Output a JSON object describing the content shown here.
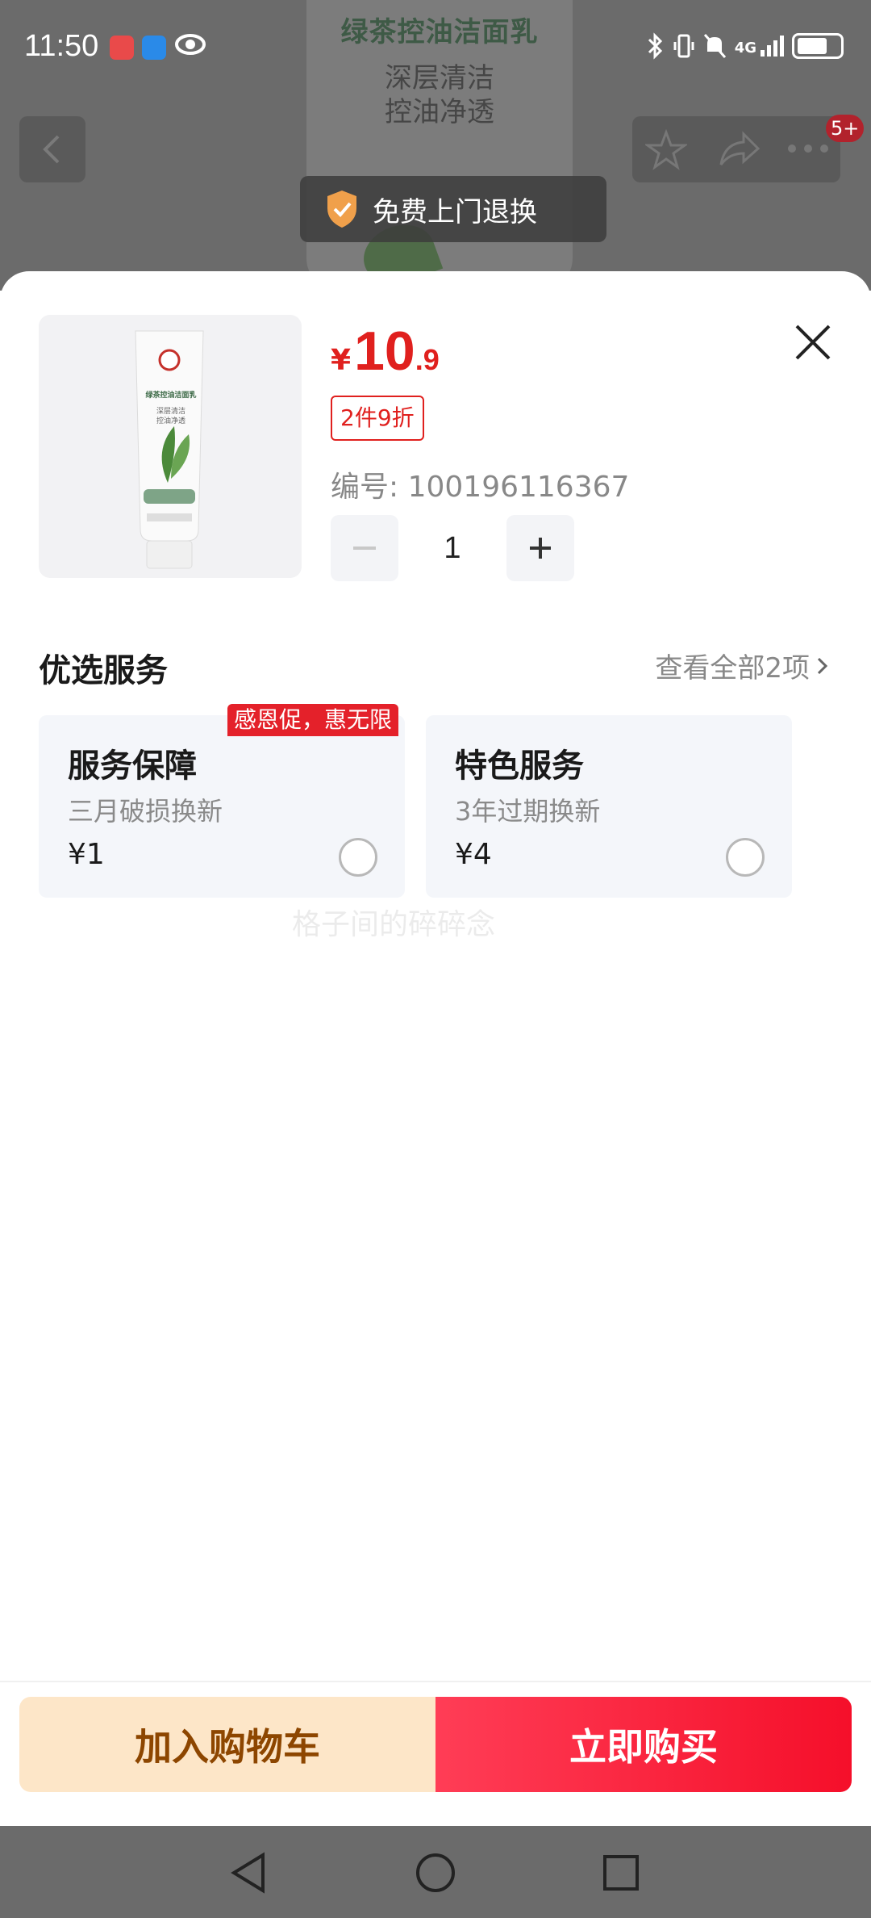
{
  "status_bar": {
    "time": "11:50",
    "icons": [
      "app-icon-red",
      "app-icon-blue",
      "eye-icon",
      "bluetooth-icon",
      "vibrate-icon",
      "mute-icon",
      "signal-4g-icon",
      "battery-icon"
    ],
    "signal_label": "4G"
  },
  "background": {
    "product_title": "绿茶控油洁面乳",
    "product_sub_1": "深层清洁",
    "product_sub_2": "控油净透",
    "message_badge": "5+",
    "return_pill": "免费上门退换"
  },
  "sheet": {
    "price": {
      "currency": "¥",
      "integer": "10",
      "decimal": ".9"
    },
    "discount_tag": "2件9折",
    "sku_label": "编号: 100196116367",
    "quantity": "1",
    "thumb": {
      "title": "绿茶控油洁面乳",
      "sub_1": "深层清洁",
      "sub_2": "控油净透"
    },
    "services": {
      "heading": "优选服务",
      "view_all": "查看全部2项",
      "promo_badge": "感恩促，惠无限",
      "cards": [
        {
          "title": "服务保障",
          "desc": "三月破损换新",
          "price": "¥1"
        },
        {
          "title": "特色服务",
          "desc": "3年过期换新",
          "price": "¥4"
        }
      ]
    },
    "watermark": "格子间的碎碎念"
  },
  "actions": {
    "add_to_cart": "加入购物车",
    "buy_now": "立即购买"
  },
  "colors": {
    "price_red": "#e0201e",
    "buy_gradient_start": "#ff3d56",
    "buy_gradient_end": "#f50f2a",
    "cart_bg": "#fde6c8",
    "cart_text": "#8d4600"
  }
}
